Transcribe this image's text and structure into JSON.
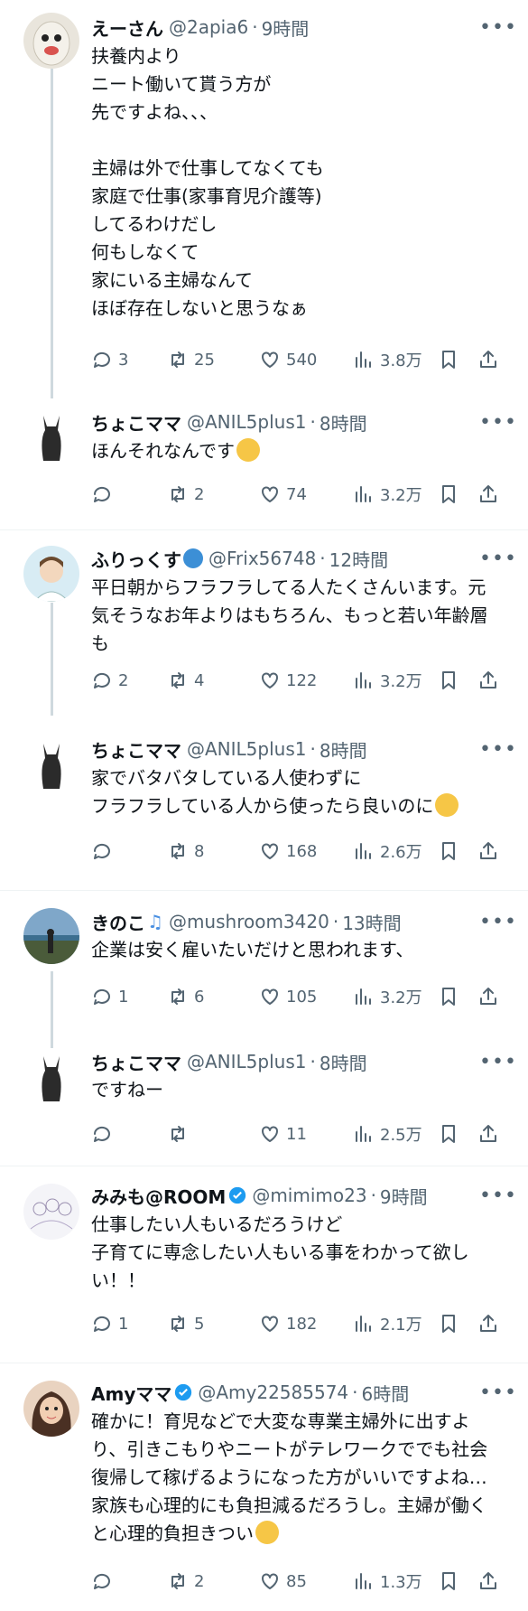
{
  "tweets": [
    {
      "name": "えーさん",
      "handle": "@2apia6",
      "time": "9時間",
      "body": "扶養内より\nニート働いて貰う方が\n先ですよね、、、\n\n主婦は外で仕事してなくても\n家庭で仕事(家事育児介護等)\nしてるわけだし\n何もしなくて\n家にいる主婦なんて\nほぼ存在しないと思うなぁ",
      "reply": "3",
      "retweet": "25",
      "like": "540",
      "views": "3.8万"
    },
    {
      "name": "ちょこママ",
      "handle": "@ANIL5plus1",
      "time": "8時間",
      "body": "ほんそれなんです",
      "reply": "",
      "retweet": "2",
      "like": "74",
      "views": "3.2万"
    },
    {
      "name": "ふりっくす",
      "handle": "@Frix56748",
      "time": "12時間",
      "body": "平日朝からフラフラしてる人たくさんいます。元気そうなお年よりはもちろん、もっと若い年齢層も",
      "reply": "2",
      "retweet": "4",
      "like": "122",
      "views": "3.2万"
    },
    {
      "name": "ちょこママ",
      "handle": "@ANIL5plus1",
      "time": "8時間",
      "body": "家でバタバタしている人使わずに\nフラフラしている人から使ったら良いのに",
      "reply": "",
      "retweet": "8",
      "like": "168",
      "views": "2.6万"
    },
    {
      "name": "きのこ",
      "handle": "@mushroom3420",
      "time": "13時間",
      "body": "企業は安く雇いたいだけと思われます、",
      "reply": "1",
      "retweet": "6",
      "like": "105",
      "views": "3.2万"
    },
    {
      "name": "ちょこママ",
      "handle": "@ANIL5plus1",
      "time": "8時間",
      "body": "ですねー",
      "reply": "",
      "retweet": "",
      "like": "11",
      "views": "2.5万"
    },
    {
      "name": "みみも@ROOM",
      "handle": "@mimimo23",
      "time": "9時間",
      "body": "仕事したい人もいるだろうけど\n子育てに専念したい人もいる事をわかって欲しい！！",
      "reply": "1",
      "retweet": "5",
      "like": "182",
      "views": "2.1万"
    },
    {
      "name": "Amyママ",
      "handle": "@Amy22585574",
      "time": "6時間",
      "body": "確かに！育児などで大変な専業主婦外に出すより、引きこもりやニートがテレワークででも社会復帰して稼げるようになった方がいいですよね…家族も心理的にも負担減るだろうし。主婦が働くと心理的負担きつい",
      "reply": "",
      "retweet": "2",
      "like": "85",
      "views": "1.3万"
    }
  ],
  "more_label": "•••",
  "dot": "·",
  "colors": {
    "text": "#0f1419",
    "muted": "#536471",
    "line": "#cfd9de",
    "verified": "#1d9bf0"
  }
}
